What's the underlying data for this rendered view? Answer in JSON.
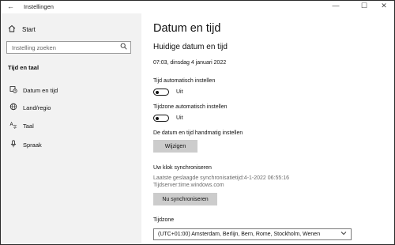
{
  "window": {
    "back_glyph": "←",
    "title": "Instellingen",
    "minimize": "—",
    "maximize": "☐",
    "close": "✕"
  },
  "sidebar": {
    "home_label": "Start",
    "home_icon": "home-icon",
    "search_placeholder": "Instelling zoeken",
    "section_title": "Tijd en taal",
    "items": [
      {
        "label": "Datum en tijd",
        "icon": "calendar-clock-icon"
      },
      {
        "label": "Land/regio",
        "icon": "globe-icon"
      },
      {
        "label": "Taal",
        "icon": "language-icon"
      },
      {
        "label": "Spraak",
        "icon": "microphone-icon"
      }
    ]
  },
  "main": {
    "page_title": "Datum en tijd",
    "current_heading": "Huidige datum en tijd",
    "current_value": "07:03, dinsdag 4 januari 2022",
    "auto_time": {
      "label": "Tijd automatisch instellen",
      "state": "Uit"
    },
    "auto_timezone": {
      "label": "Tijdzone automatisch instellen",
      "state": "Uit"
    },
    "manual_label": "De datum en tijd handmatig instellen",
    "change_button": "Wijzigen",
    "sync_heading": "Uw klok synchroniseren",
    "last_sync": "Laatste geslaagde synchronisatietijd:4-1-2022 06:55:16",
    "time_server": "Tijdserver:time.windows.com",
    "sync_button": "Nu synchroniseren",
    "timezone_label": "Tijdzone",
    "timezone_value": "(UTC+01:00) Amsterdam, Berlijn, Bern, Rome, Stockholm, Wenen"
  }
}
